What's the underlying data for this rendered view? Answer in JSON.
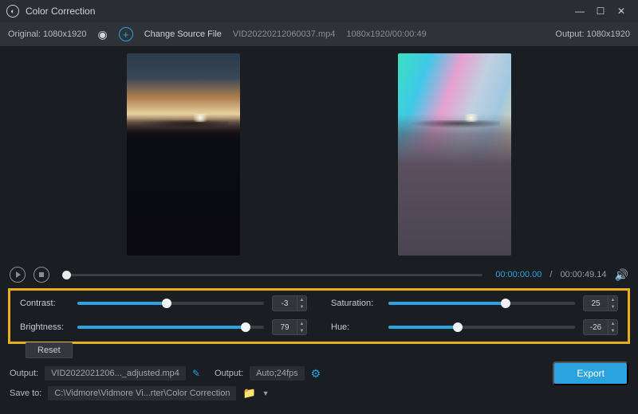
{
  "window": {
    "title": "Color Correction"
  },
  "source": {
    "original_label": "Original: 1080x1920",
    "change_label": "Change Source File",
    "filename": "VID20220212060037.mp4",
    "fileinfo": "1080x1920/00:00:49",
    "output_label": "Output: 1080x1920"
  },
  "playback": {
    "current": "00:00:00.00",
    "sep": "/",
    "duration": "00:00:49.14"
  },
  "sliders": {
    "contrast": {
      "label": "Contrast:",
      "value": "-3",
      "pct": 48
    },
    "brightness": {
      "label": "Brightness:",
      "value": "79",
      "pct": 90
    },
    "saturation": {
      "label": "Saturation:",
      "value": "25",
      "pct": 63
    },
    "hue": {
      "label": "Hue:",
      "value": "-26",
      "pct": 37
    }
  },
  "reset_label": "Reset",
  "output": {
    "label": "Output:",
    "filename": "VID2022021206..._adjusted.mp4",
    "settings_label": "Output:",
    "settings_value": "Auto;24fps",
    "export_label": "Export"
  },
  "save": {
    "label": "Save to:",
    "path": "C:\\Vidmore\\Vidmore Vi...rter\\Color Correction"
  }
}
